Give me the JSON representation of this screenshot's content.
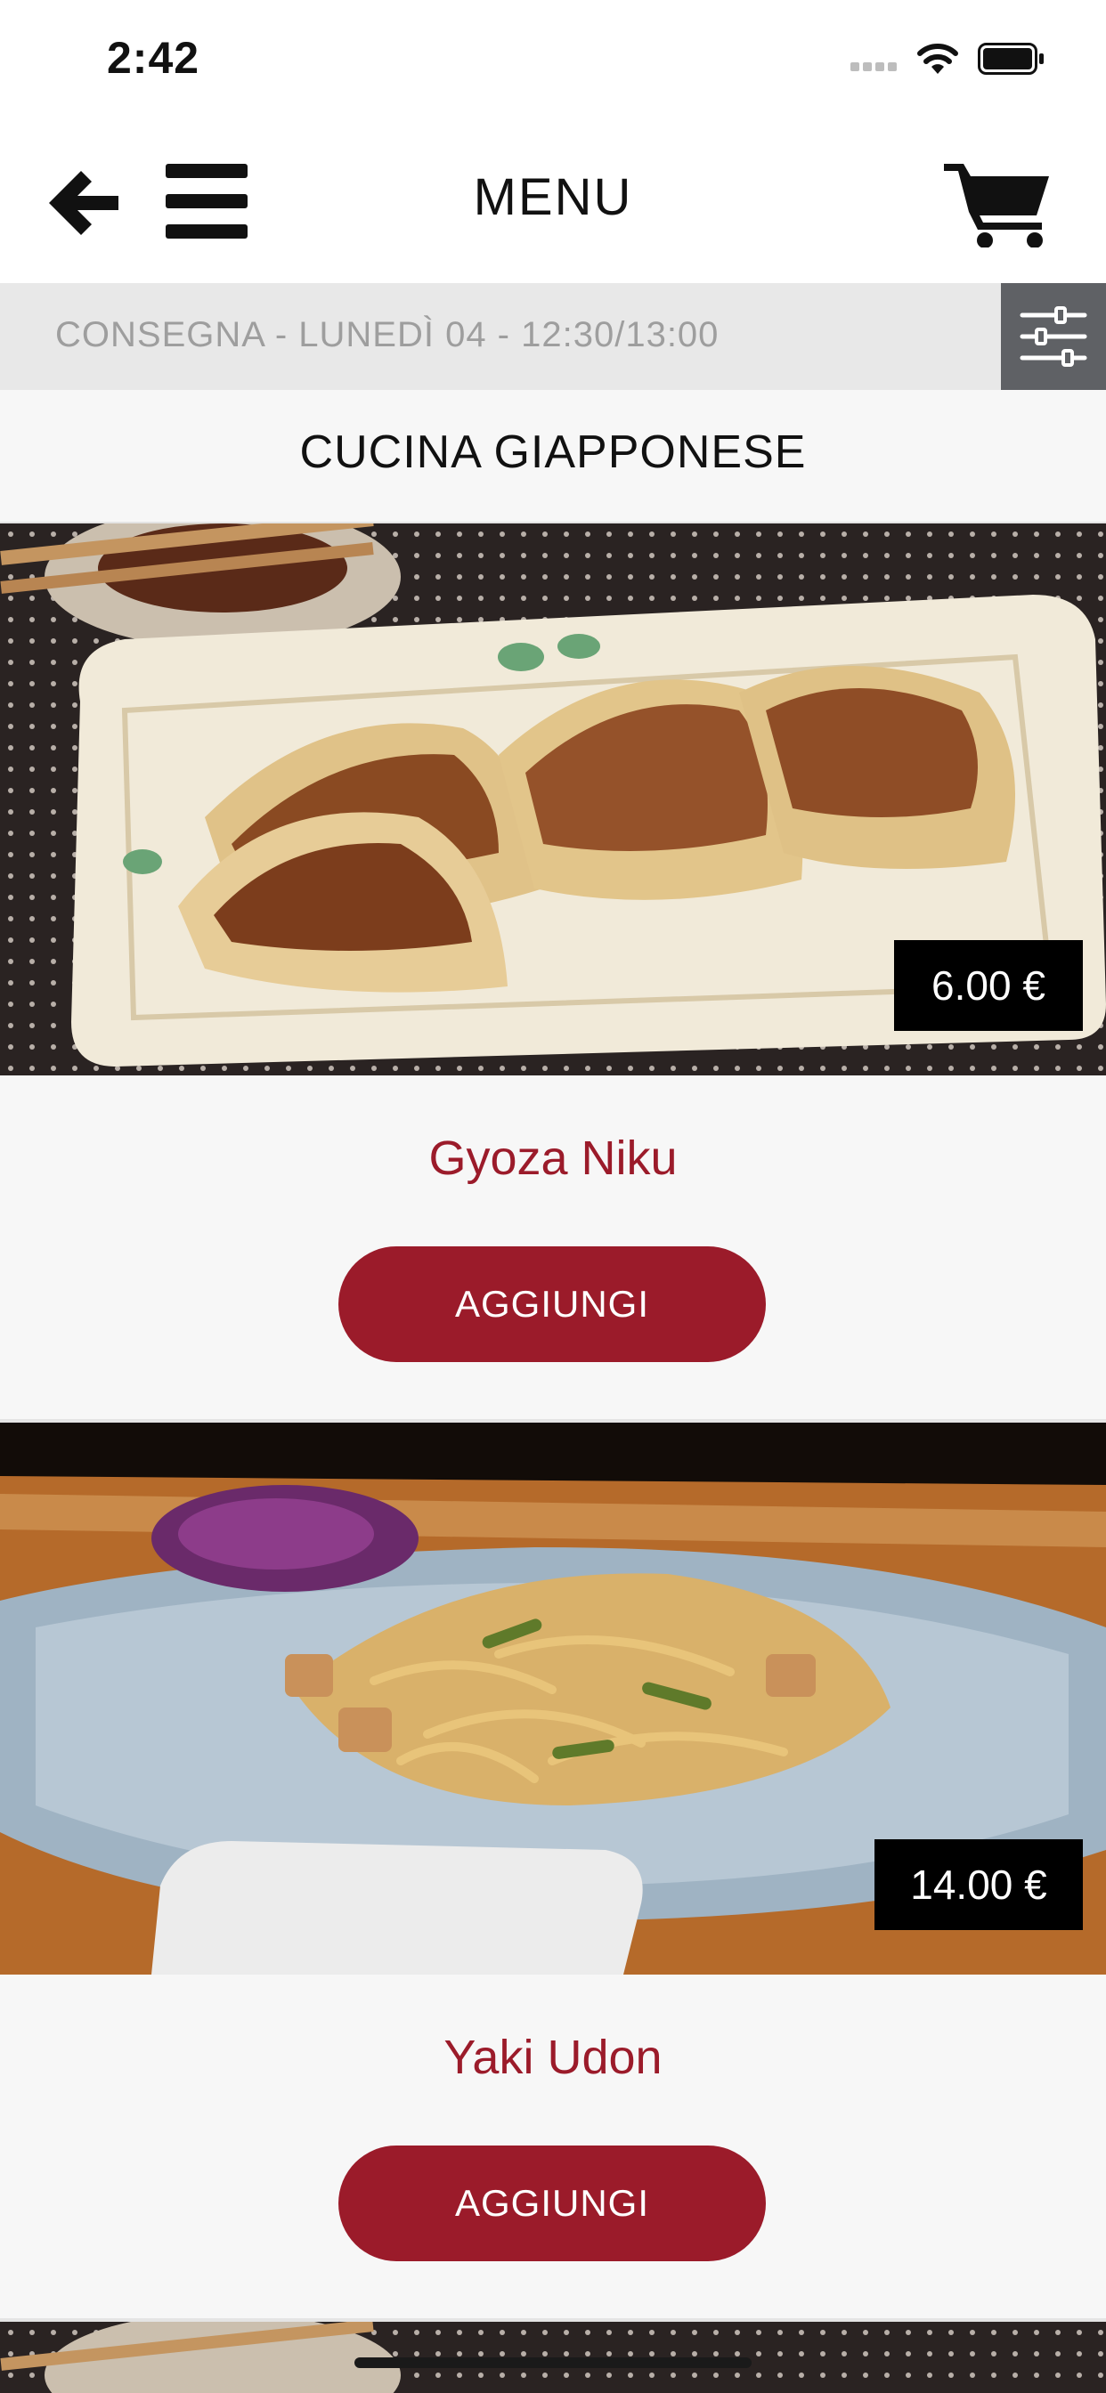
{
  "status_bar": {
    "time": "2:42"
  },
  "navbar": {
    "title": "MENU",
    "back_icon": "arrow-left-icon",
    "menu_icon": "hamburger-icon",
    "cart_icon": "cart-icon"
  },
  "delivery": {
    "text": "CONSEGNA - LUNEDÌ 04 - 12:30/13:00",
    "filter_icon": "sliders-icon"
  },
  "category": {
    "title": "CUCINA GIAPPONESE"
  },
  "products": [
    {
      "name": "Gyoza Niku",
      "price": "6.00 €",
      "button": "AGGIUNGI"
    },
    {
      "name": "Yaki Udon",
      "price": "14.00 €",
      "button": "AGGIUNGI"
    }
  ],
  "colors": {
    "accent": "#9b1b2a",
    "banner": "#e8e8e8",
    "filter_button": "#5f6165",
    "background": "#f7f7f7"
  }
}
